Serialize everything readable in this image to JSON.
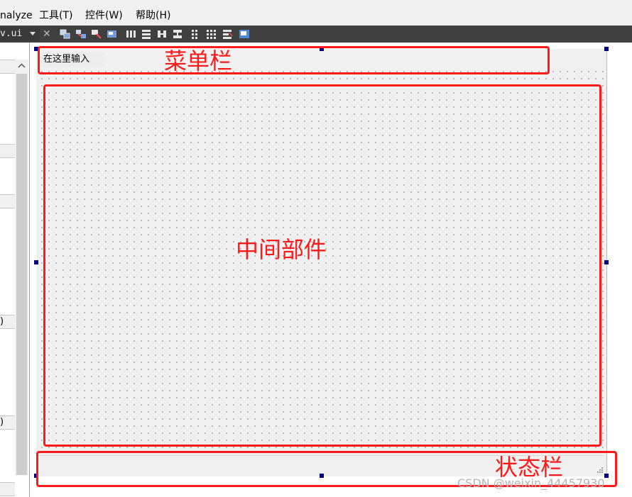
{
  "menubar": {
    "items": [
      "nalyze",
      "工具(T)",
      "控件(W)",
      "帮助(H)"
    ]
  },
  "toolbar": {
    "file_name": "v.ui",
    "close_glyph": "✕",
    "buttons": [
      "edit-widgets-icon",
      "edit-signals-slots-icon",
      "edit-buddies-icon",
      "edit-tab-order-icon",
      "layout-horizontal-icon",
      "layout-vertical-icon",
      "layout-horizontal-splitter-icon",
      "layout-vertical-splitter-icon",
      "layout-form-icon",
      "layout-grid-icon",
      "break-layout-icon",
      "adjust-size-icon"
    ]
  },
  "left_panel": {
    "paren_1": ")",
    "paren_2": ")"
  },
  "form": {
    "menu_placeholder": "在这里输入"
  },
  "annotations": {
    "menubar_label": "菜单栏",
    "central_label": "中间部件",
    "statusbar_label": "状态栏",
    "color": "#ff1a1a"
  },
  "watermark": "CSDN @weixin_44457930"
}
